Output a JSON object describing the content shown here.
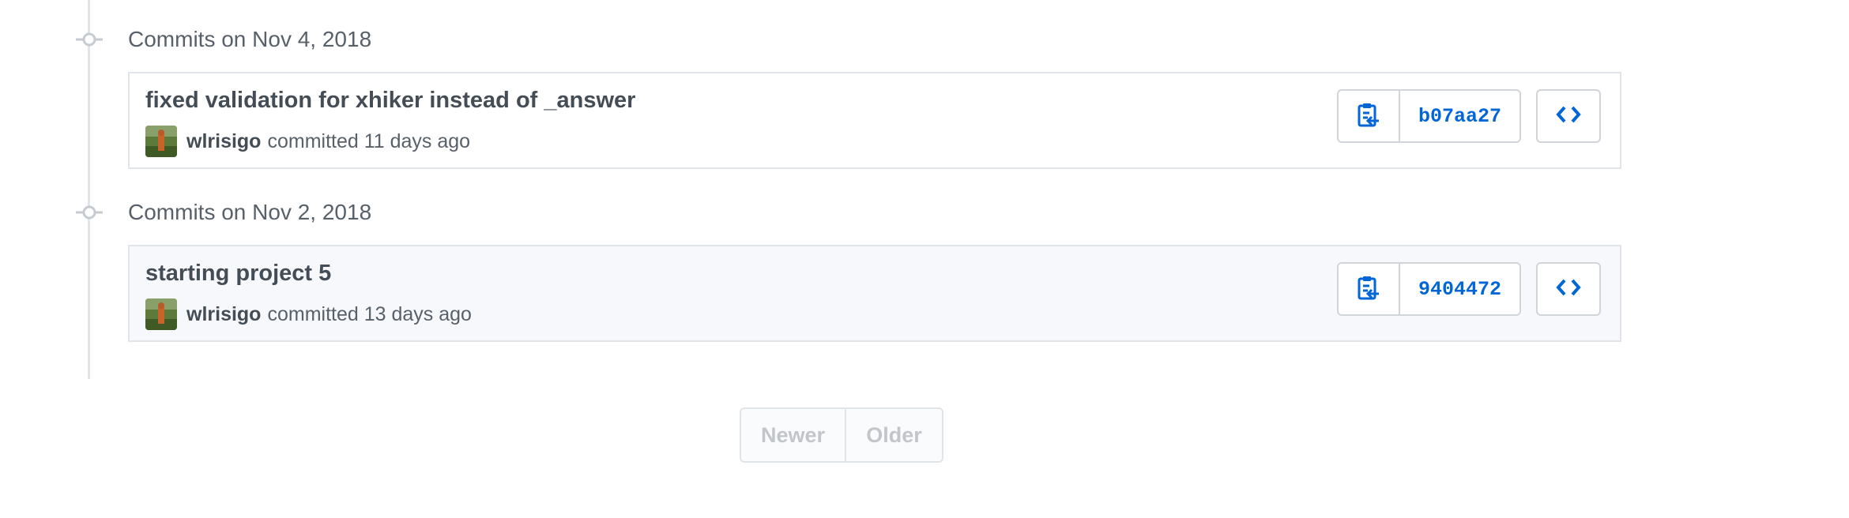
{
  "groups": [
    {
      "date_label": "Commits on Nov 4, 2018",
      "commit": {
        "message": "fixed validation for xhiker instead of _answer",
        "author": "wlrisigo",
        "action": "committed 11 days ago",
        "sha": "b07aa27"
      }
    },
    {
      "date_label": "Commits on Nov 2, 2018",
      "commit": {
        "message": "starting project 5",
        "author": "wlrisigo",
        "action": "committed 13 days ago",
        "sha": "9404472"
      }
    }
  ],
  "pagination": {
    "newer_label": "Newer",
    "older_label": "Older"
  },
  "icons": {
    "timeline_node": "git-commit-icon",
    "copy": "clippy-icon",
    "browse": "code-icon"
  },
  "colors": {
    "link": "#0366d6",
    "border": "#e1e4e8",
    "muted_text": "#586069",
    "highlight_bg": "#f6f8fc",
    "disabled_text": "#c2c5c9"
  }
}
